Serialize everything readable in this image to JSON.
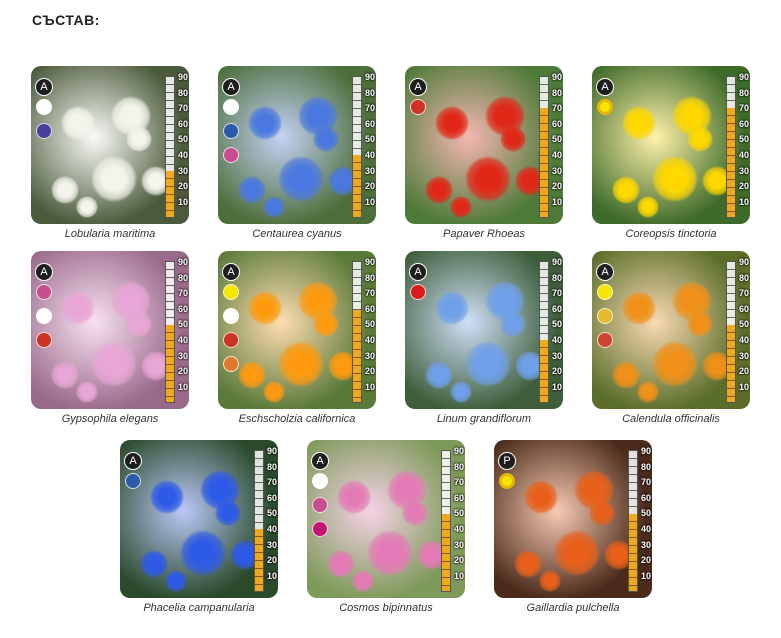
{
  "page_title": "СЪСТАВ:",
  "scale_labels": [
    "90",
    "80",
    "70",
    "60",
    "50",
    "40",
    "30",
    "20",
    "10"
  ],
  "plants": [
    {
      "name": "Lobularia maritima",
      "badge": "A",
      "colors": [
        "#ffffff",
        "#4a3e9c"
      ],
      "fill_pct": 0.33,
      "bg": "#4a5a3a",
      "petal": "#f4f4ec"
    },
    {
      "name": "Centaurea cyanus",
      "badge": "A",
      "colors": [
        "#ffffff",
        "#2d5aa8",
        "#c64d8e"
      ],
      "fill_pct": 0.44,
      "bg": "#4d6e3a",
      "petal": "#4a78e0"
    },
    {
      "name": "Papaver Rhoeas",
      "badge": "A",
      "colors": [
        "#cc3322"
      ],
      "fill_pct": 0.78,
      "bg": "#4e7a38",
      "petal": "#e02818"
    },
    {
      "name": "Coreopsis tinctoria",
      "badge": "A",
      "colors": [
        "#f6e600"
      ],
      "ring": true,
      "fill_pct": 0.78,
      "bg": "#3e6a2a",
      "petal": "#ffd800"
    },
    {
      "name": "Gypsophila elegans",
      "badge": "A",
      "colors": [
        "#c64d8e",
        "#ffffff",
        "#cc3322"
      ],
      "fill_pct": 0.55,
      "bg": "#9a6a8a",
      "petal": "#e8a6d6"
    },
    {
      "name": "Eschscholzia californica",
      "badge": "A",
      "colors": [
        "#f6e600",
        "#ffffff",
        "#cc3322",
        "#e07a2a"
      ],
      "fill_pct": 0.66,
      "bg": "#5a7a3a",
      "petal": "#ff9a10"
    },
    {
      "name": "Linum grandiflorum",
      "badge": "A",
      "colors": [
        "#dd1a1a"
      ],
      "fill_pct": 0.44,
      "bg": "#3e5e3a",
      "petal": "#6fa0ea"
    },
    {
      "name": "Calendula officinalis",
      "badge": "A",
      "colors": [
        "#f6e600",
        "#e6b830",
        "#cc4433"
      ],
      "fill_pct": 0.55,
      "bg": "#5a6e2a",
      "petal": "#f09018"
    },
    {
      "name": "Phacelia campanularia",
      "badge": "A",
      "colors": [
        "#2d5aa8"
      ],
      "fill_pct": 0.44,
      "bg": "#2a4a2a",
      "petal": "#2e5ae8"
    },
    {
      "name": "Cosmos bipinnatus",
      "badge": "A",
      "colors": [
        "#ffffff",
        "#c64d8e",
        "#c01870"
      ],
      "fill_pct": 0.55,
      "bg": "#7e9a5a",
      "petal": "#e47ab6"
    },
    {
      "name": "Gaillardia pulchella",
      "badge": "P",
      "colors": [
        "#f6e600"
      ],
      "ring": true,
      "fill_pct": 0.55,
      "bg": "#4a2a1a",
      "petal": "#e8601a"
    }
  ]
}
